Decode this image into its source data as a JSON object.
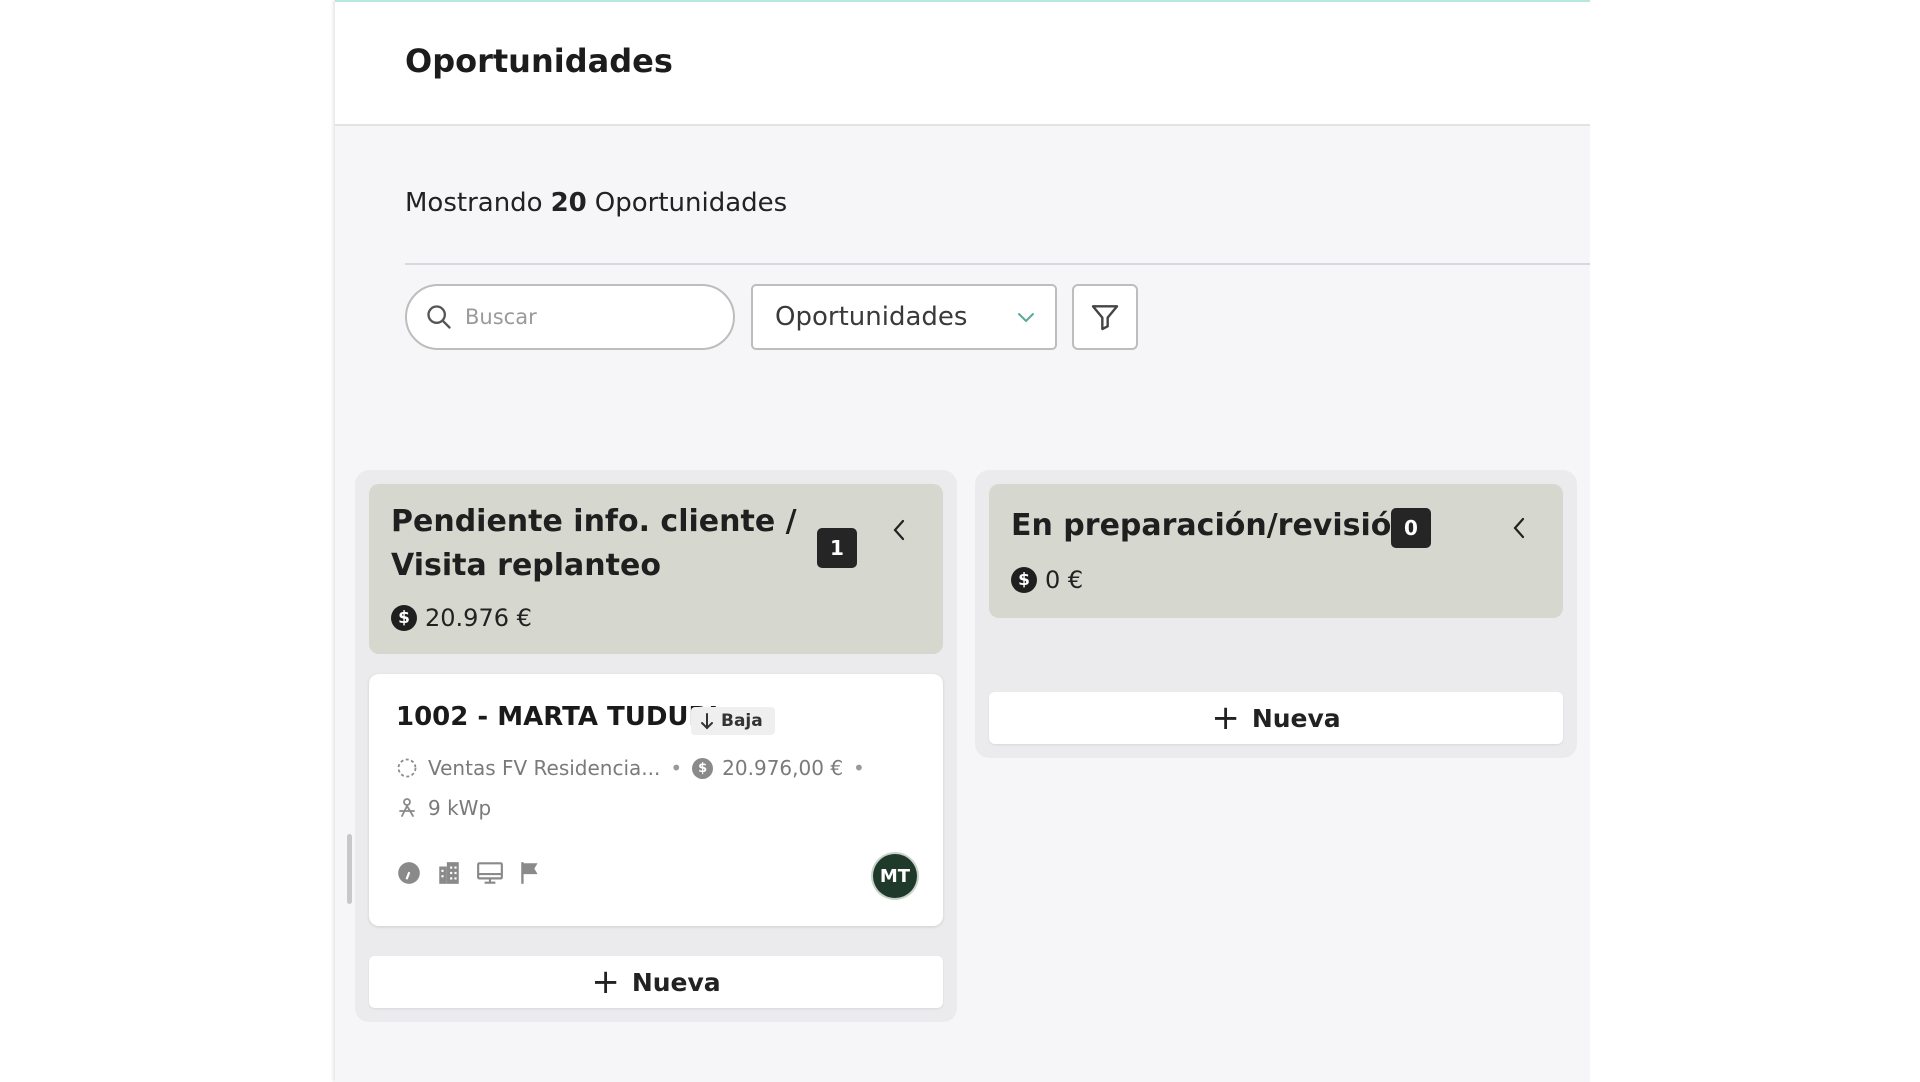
{
  "header": {
    "title": "Oportunidades"
  },
  "summary": {
    "prefix": "Mostrando",
    "count": "20",
    "suffix": "Oportunidades"
  },
  "toolbar": {
    "search_placeholder": "Buscar",
    "view_select_value": "Oportunidades",
    "filter_icon": "filter-icon"
  },
  "columns": [
    {
      "title_line1": "Pendiente info. cliente /",
      "title_line2": "Visita replanteo",
      "count": "1",
      "amount": "20.976 €",
      "add_label": "Nueva",
      "cards": [
        {
          "title": "1002 - MARTA TUDURI",
          "priority": "Baja",
          "pipeline": "Ventas FV Residencia...",
          "value": "20.976,00 €",
          "power": "9 kWp",
          "avatar_initials": "MT"
        }
      ]
    },
    {
      "title": "En preparación/revisión",
      "count": "0",
      "amount": "0 €",
      "add_label": "Nueva",
      "cards": []
    }
  ],
  "colors": {
    "column_header_bg": "#d6d7cf",
    "badge_bg": "#252525",
    "avatar_bg": "#1f3a2b",
    "accent_top": "#b9e6e0"
  }
}
